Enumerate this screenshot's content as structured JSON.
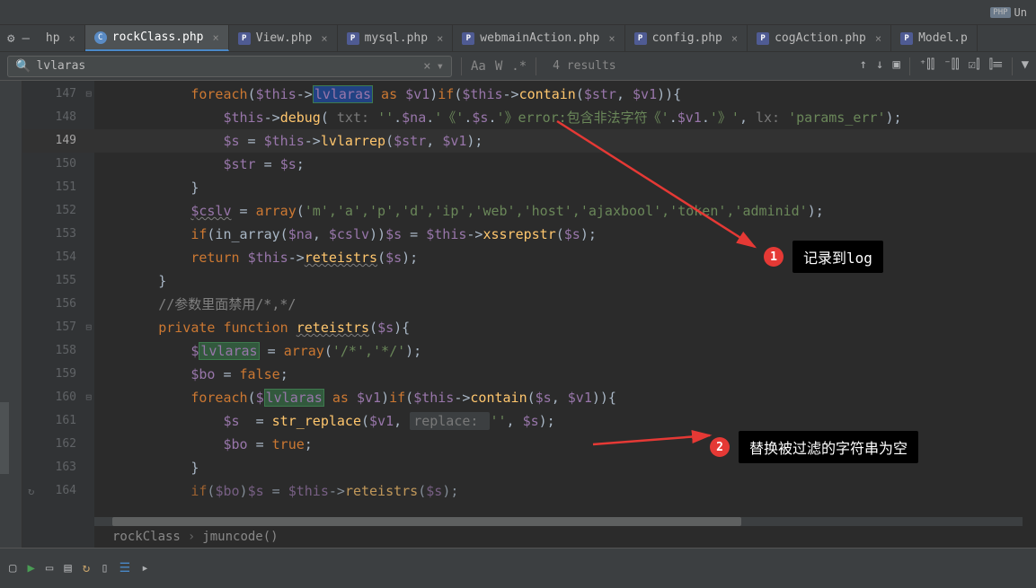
{
  "top": {
    "un_label": "Un"
  },
  "tabs": [
    {
      "label": "hp",
      "icon": "",
      "active": false,
      "partial": true
    },
    {
      "label": "rockClass.php",
      "icon": "class",
      "active": true
    },
    {
      "label": "View.php",
      "icon": "php",
      "active": false
    },
    {
      "label": "mysql.php",
      "icon": "php",
      "active": false
    },
    {
      "label": "webmainAction.php",
      "icon": "php",
      "active": false
    },
    {
      "label": "config.php",
      "icon": "php",
      "active": false
    },
    {
      "label": "cogAction.php",
      "icon": "php",
      "active": false
    },
    {
      "label": "Model.p",
      "icon": "php",
      "active": false,
      "partial": true
    }
  ],
  "search": {
    "value": "lvlaras",
    "results": "4 results"
  },
  "lines": [
    {
      "n": "147",
      "fold": true
    },
    {
      "n": "148"
    },
    {
      "n": "149",
      "current": true
    },
    {
      "n": "150"
    },
    {
      "n": "151"
    },
    {
      "n": "152"
    },
    {
      "n": "153"
    },
    {
      "n": "154"
    },
    {
      "n": "155"
    },
    {
      "n": "156"
    },
    {
      "n": "157",
      "fold": true
    },
    {
      "n": "158"
    },
    {
      "n": "159"
    },
    {
      "n": "160",
      "fold": true
    },
    {
      "n": "161"
    },
    {
      "n": "162"
    },
    {
      "n": "163"
    },
    {
      "n": "164",
      "refresh": true
    }
  ],
  "code": {
    "l147": {
      "pre": "           ",
      "kw1": "foreach",
      "p1": "(",
      "var1": "$this",
      "arrow": "->",
      "hl": "lvlaras",
      "as": " as ",
      "var2": "$v1",
      "p2": ")",
      "kw2": "if",
      "p3": "(",
      "var3": "$this",
      "arrow2": "->",
      "fn": "contain",
      "p4": "(",
      "var4": "$str",
      "c": ", ",
      "var5": "$v1",
      "p5": ")){"
    },
    "l148": {
      "pre": "               ",
      "var1": "$this",
      "arrow": "->",
      "fn": "debug",
      "p1": "( ",
      "hint1": "txt: ",
      "s1": "''",
      "d1": ".",
      "var2": "$na",
      "d2": ".",
      "s2": "'《'",
      "d3": ".",
      "var3": "$s",
      "d4": ".",
      "s3": "'》error:包含非法字符《'",
      "d5": ".",
      "var4": "$v1",
      "d6": ".",
      "s4": "'》'",
      "c": ", ",
      "hint2": "lx: ",
      "s5": "'params_err'",
      "p2": ");"
    },
    "l149": {
      "pre": "               ",
      "var1": "$s",
      "eq": " = ",
      "var2": "$this",
      "arrow": "->",
      "fn": "lvlarrep",
      "p1": "(",
      "var3": "$str",
      "c": ", ",
      "var4": "$v1",
      "p2": ");"
    },
    "l150": {
      "pre": "               ",
      "var1": "$str",
      "eq": " = ",
      "var2": "$s",
      "p": ";"
    },
    "l151": {
      "pre": "           }",
      "txt": ""
    },
    "l152": {
      "pre": "           ",
      "var1": "$cslv",
      "eq": " = ",
      "kw": "array",
      "p1": "(",
      "s": "'m','a','p','d','ip','web','host','ajaxbool','token','adminid'",
      "p2": ");"
    },
    "l153": {
      "pre": "           ",
      "kw": "if",
      "p1": "(in_array(",
      "var1": "$na",
      "c": ", ",
      "var2": "$cslv",
      "p2": "))",
      "var3": "$s",
      "eq": " = ",
      "var4": "$this",
      "arrow": "->",
      "fn": "xssrepstr",
      "p3": "(",
      "var5": "$s",
      "p4": ");"
    },
    "l154": {
      "pre": "           ",
      "kw": "return",
      "sp": " ",
      "var1": "$this",
      "arrow": "->",
      "fn": "reteistrs",
      "p1": "(",
      "var2": "$s",
      "p2": ");"
    },
    "l155": {
      "pre": "       }",
      "txt": ""
    },
    "l156": {
      "pre": "       ",
      "com": "//参数里面禁用/*,*/"
    },
    "l157": {
      "pre": "       ",
      "kw1": "private",
      "sp": " ",
      "kw2": "function",
      "sp2": " ",
      "fn": "reteistrs",
      "p1": "(",
      "var": "$s",
      "p2": "){"
    },
    "l158": {
      "pre": "           ",
      "var1": "$",
      "hl": "lvlaras",
      "eq": " = ",
      "kw": "array",
      "p1": "(",
      "s": "'/*','*/'",
      "p2": ");"
    },
    "l159": {
      "pre": "           ",
      "var": "$bo",
      "eq": " = ",
      "kw": "false",
      "p": ";"
    },
    "l160": {
      "pre": "           ",
      "kw1": "foreach",
      "p1": "(",
      "var1": "$",
      "hl": "lvlaras",
      "as": " as ",
      "var2": "$v1",
      "p2": ")",
      "kw2": "if",
      "p3": "(",
      "var3": "$this",
      "arrow": "->",
      "fn": "contain",
      "p4": "(",
      "var4": "$s",
      "c": ", ",
      "var5": "$v1",
      "p5": ")){"
    },
    "l161": {
      "pre": "               ",
      "var1": "$s",
      "eq": "  = ",
      "fn": "str_replace",
      "p1": "(",
      "var2": "$v1",
      "c": ", ",
      "hint": "replace: ",
      "s": "''",
      "c2": ", ",
      "var3": "$s",
      "p2": ");"
    },
    "l162": {
      "pre": "               ",
      "var": "$bo",
      "eq": " = ",
      "kw": "true",
      "p": ";"
    },
    "l163": {
      "pre": "           }",
      "txt": ""
    },
    "l164": {
      "pre": "           ",
      "kw": "if",
      "p1": "(",
      "var1": "$bo",
      "p2": ")",
      "var2": "$s",
      "eq": " = ",
      "var3": "$this",
      "arrow": "->",
      "fn": "reteistrs",
      "p3": "(",
      "var4": "$s",
      "p4": ");"
    }
  },
  "breadcrumb": {
    "a": "rockClass",
    "b": "jmuncode()"
  },
  "annotations": [
    {
      "num": "1",
      "label": "记录到log"
    },
    {
      "num": "2",
      "label": "替换被过滤的字符串为空"
    }
  ]
}
